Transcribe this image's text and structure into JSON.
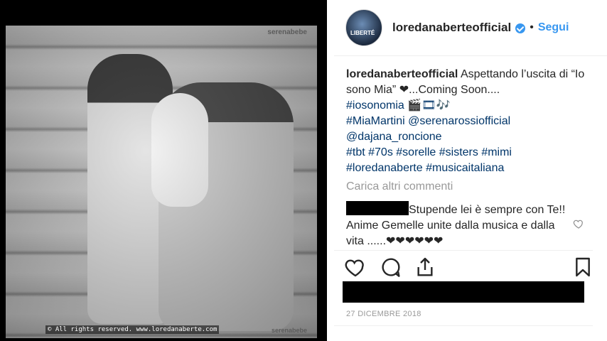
{
  "photo": {
    "watermark_top": "serenabebe",
    "rights": "© All rights reserved. www.loredanaberte.com",
    "watermark_bottom": "serenabebe"
  },
  "header": {
    "avatar_text": "LIBERTÉ",
    "username": "loredanaberteofficial",
    "separator": "•",
    "follow_label": "Segui"
  },
  "caption": {
    "username": "loredanaberteofficial",
    "text": "Aspettando l’uscita di “Io sono Mia” ❤...Coming Soon....",
    "hashtag_iosonomia": "#iosonomia 🎬🎞🎶",
    "line_miamartini": "#MiaMartini @serenarossiofficial",
    "line_dajana": "@dajana_roncione",
    "line_tags": "#tbt #70s #sorelle #sisters #mimi",
    "line_tags2": "#loredanaberte #musicaitaliana"
  },
  "load_more": "Carica altri commenti",
  "comment": {
    "text": "Stupende lei è sempre con Te!! Anime Gemelle unite dalla musica e dalla vita ......❤❤❤❤❤❤"
  },
  "actions": {
    "icons": [
      "heart-icon",
      "comment-icon",
      "share-icon",
      "bookmark-icon"
    ]
  },
  "date": "27 DICEMBRE 2018",
  "colors": {
    "link": "#003569",
    "follow": "#3897f0",
    "muted": "#999999"
  }
}
